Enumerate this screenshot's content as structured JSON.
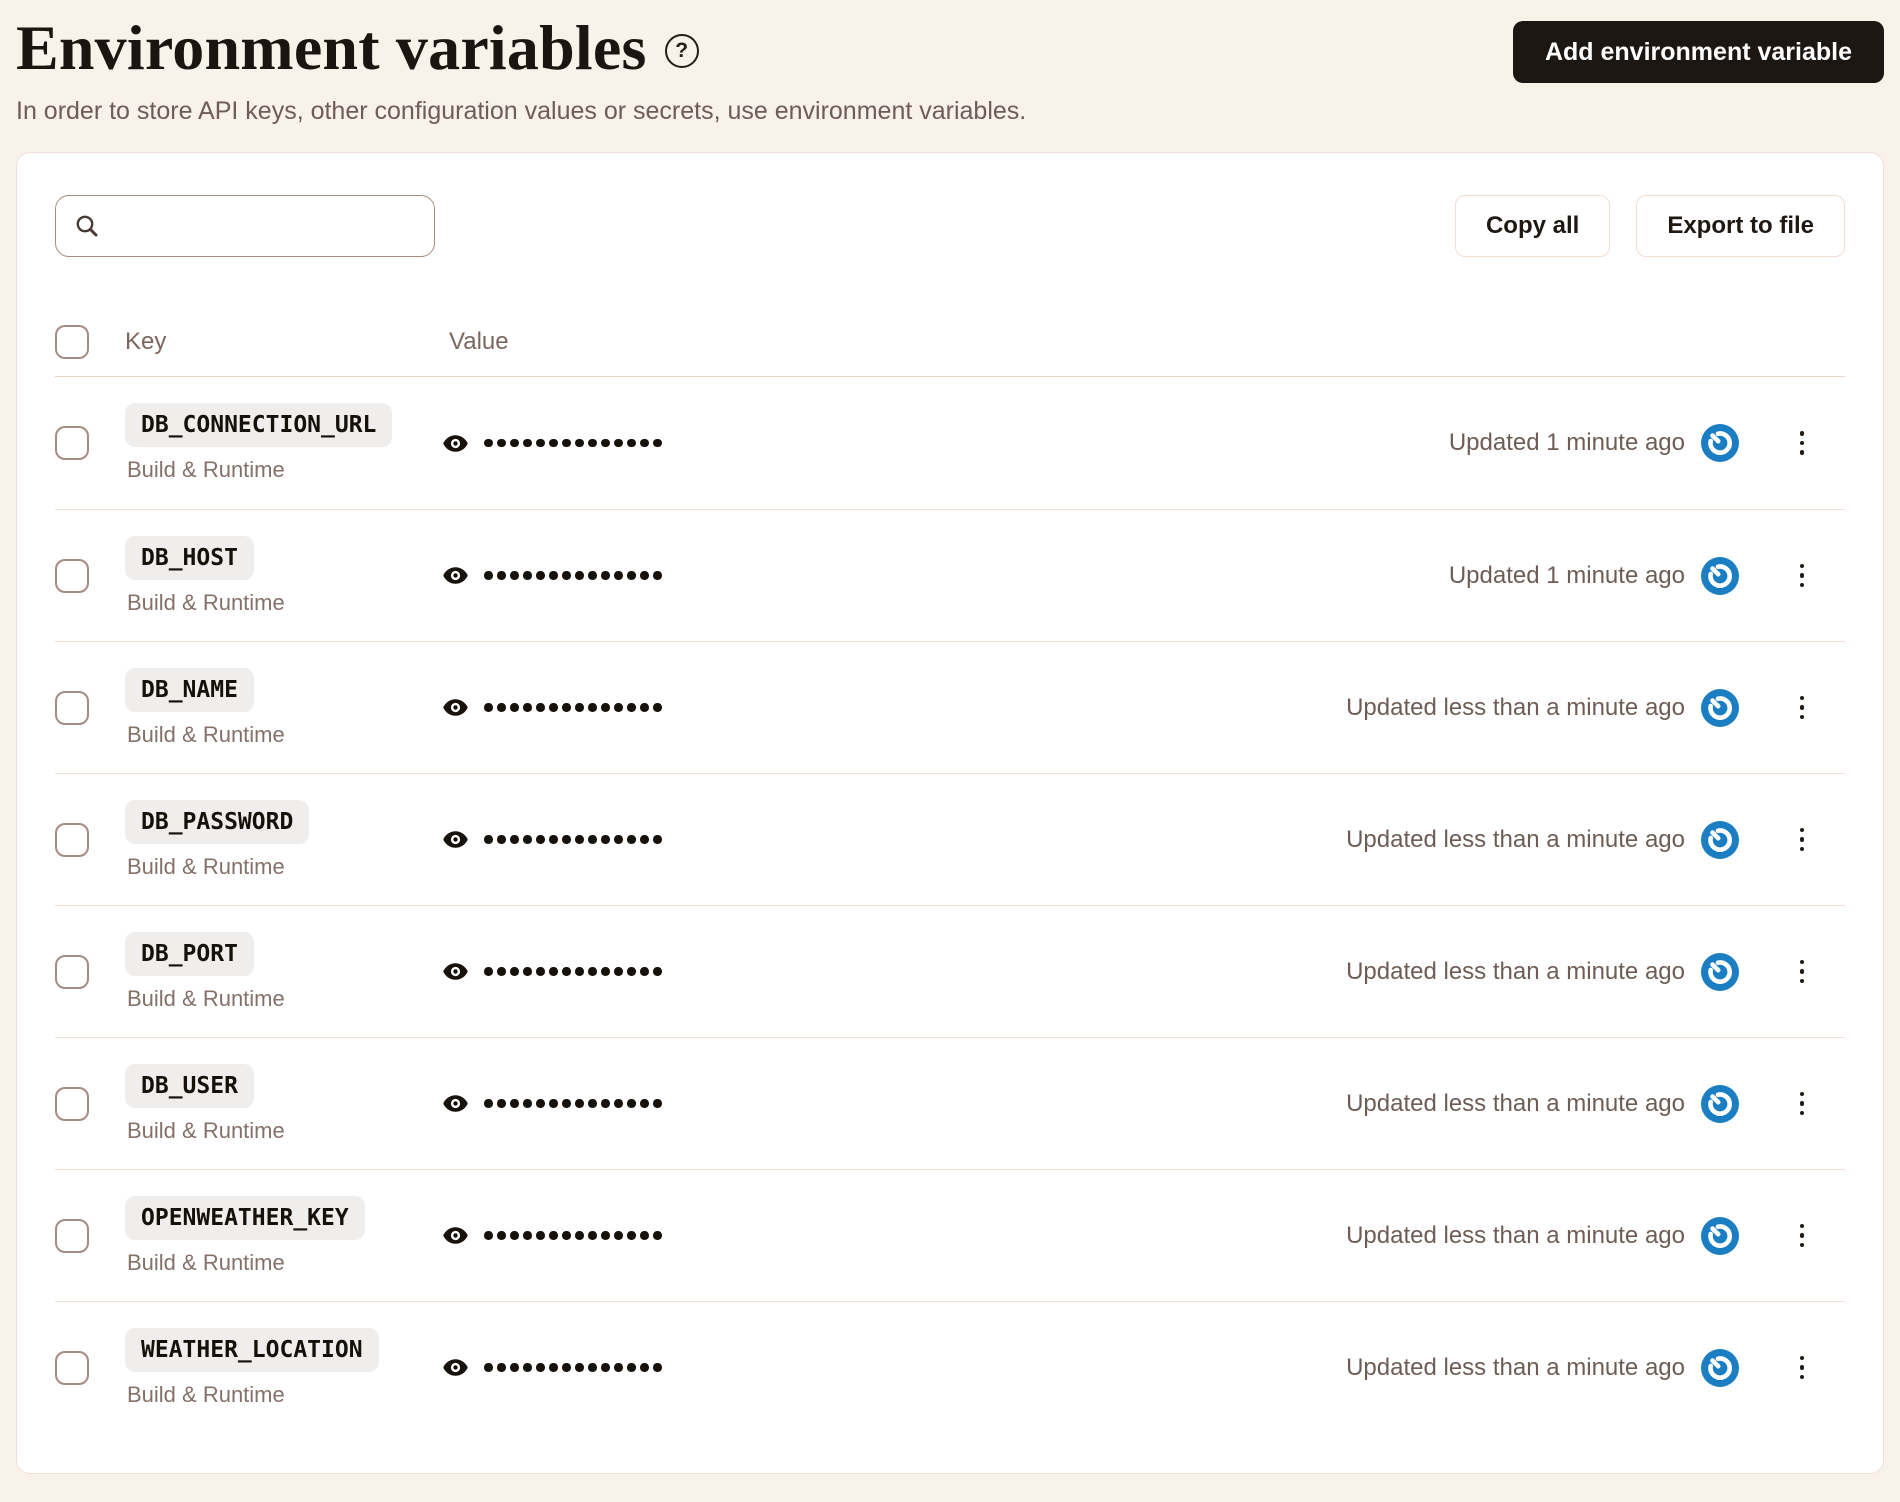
{
  "page": {
    "title": "Environment variables",
    "subtitle": "In order to store API keys, other configuration values or secrets, use environment variables.",
    "add_button_label": "Add environment variable"
  },
  "toolbar": {
    "search_placeholder": "",
    "copy_all_label": "Copy all",
    "export_label": "Export to file"
  },
  "table": {
    "columns": {
      "key": "Key",
      "value": "Value"
    },
    "masked_dot_count": 14,
    "rows": [
      {
        "key": "DB_CONNECTION_URL",
        "scope": "Build & Runtime",
        "updated": "Updated 1 minute ago"
      },
      {
        "key": "DB_HOST",
        "scope": "Build & Runtime",
        "updated": "Updated 1 minute ago"
      },
      {
        "key": "DB_NAME",
        "scope": "Build & Runtime",
        "updated": "Updated less than a minute ago"
      },
      {
        "key": "DB_PASSWORD",
        "scope": "Build & Runtime",
        "updated": "Updated less than a minute ago"
      },
      {
        "key": "DB_PORT",
        "scope": "Build & Runtime",
        "updated": "Updated less than a minute ago"
      },
      {
        "key": "DB_USER",
        "scope": "Build & Runtime",
        "updated": "Updated less than a minute ago"
      },
      {
        "key": "OPENWEATHER_KEY",
        "scope": "Build & Runtime",
        "updated": "Updated less than a minute ago"
      },
      {
        "key": "WEATHER_LOCATION",
        "scope": "Build & Runtime",
        "updated": "Updated less than a minute ago"
      }
    ]
  },
  "icons": {
    "help": "question-circle-icon",
    "search": "search-icon",
    "reveal": "eye-icon",
    "sync": "sync-power-icon",
    "row_menu": "kebab-menu-icon"
  },
  "colors": {
    "page_background": "#f8f2eb",
    "card_background": "#ffffff",
    "primary_button": "#1c1713",
    "accent_blue": "#1b7ec3",
    "divider": "#f2ded5",
    "chip_background": "#f0eeec",
    "muted_text": "#6e5d55"
  }
}
